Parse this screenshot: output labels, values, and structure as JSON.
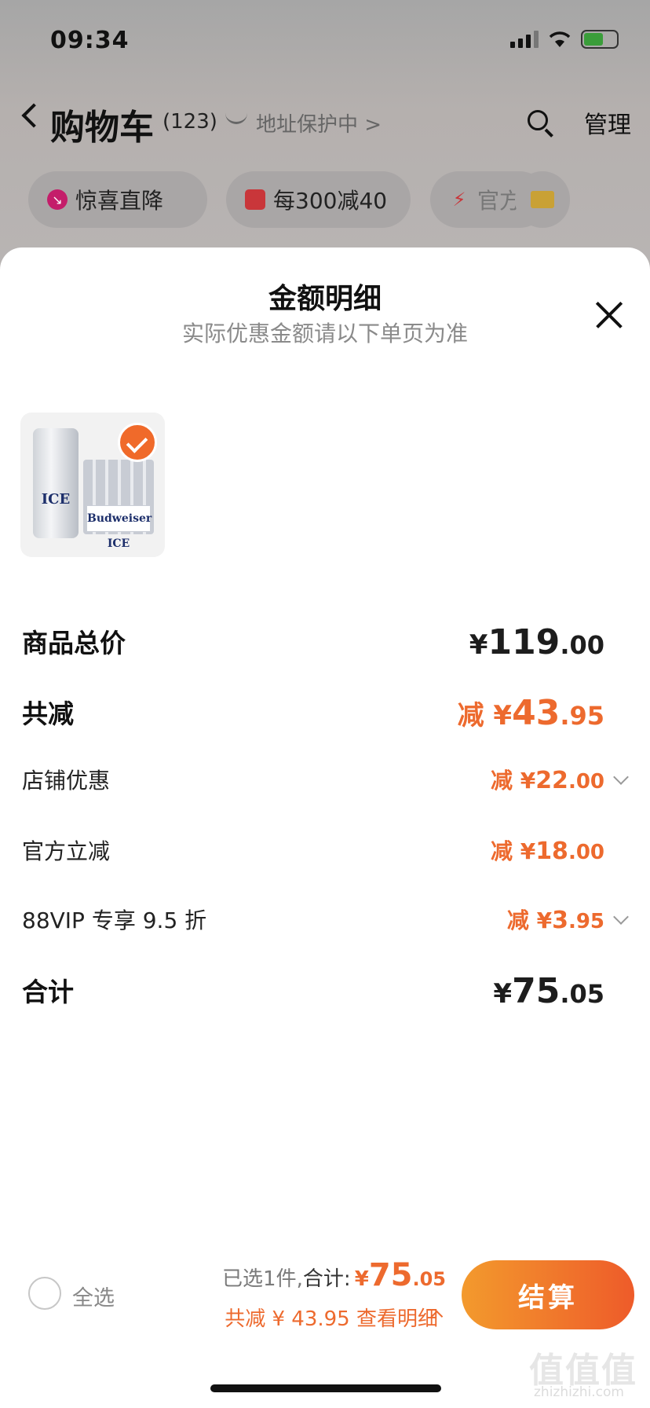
{
  "status_bar": {
    "time": "09:34"
  },
  "nav": {
    "title": "购物车",
    "count": "(123)",
    "address_text": "地址保护中 >",
    "manage": "管理"
  },
  "chips": [
    {
      "label": "惊喜直降",
      "icon": "arrow-down-icon",
      "color": "#d4206e"
    },
    {
      "label": "每300减40",
      "icon": "shop-icon",
      "color": "#e0423a"
    },
    {
      "label": "官方",
      "icon": "lightning-icon",
      "color": "#e0423a"
    }
  ],
  "sheet": {
    "title": "金额明细",
    "subtitle": "实际优惠金额请以下单页为准",
    "product_image": {
      "can_text": "ICE",
      "case_text": "Budweiser ICE"
    }
  },
  "breakdown": {
    "total_price": {
      "label": "商品总价",
      "prefix": "¥",
      "int": "119",
      "dec": ".00"
    },
    "total_discount": {
      "label": "共减",
      "prefix": "减 ¥",
      "int": "43",
      "dec": ".95"
    },
    "store_discount": {
      "label": "店铺优惠",
      "prefix": "减 ¥",
      "int": "22",
      "dec": ".00"
    },
    "official_discount": {
      "label": "官方立减",
      "prefix": "减 ¥",
      "int": "18",
      "dec": ".00"
    },
    "vip_discount": {
      "label": "88VIP 专享 9.5 折",
      "prefix": "减 ¥",
      "int": "3",
      "dec": ".95"
    },
    "grand_total": {
      "label": "合计",
      "prefix": "¥",
      "int": "75",
      "dec": ".05"
    }
  },
  "bottom_bar": {
    "select_all": "全选",
    "selected_count": "已选1件,",
    "total_label": "合计:",
    "total_yen": "¥",
    "total_int": "75",
    "total_dec": ".05",
    "discount_summary": "共减 ¥ 43.95 查看明细",
    "checkout": "结算"
  },
  "watermark": {
    "main": "值值值",
    "sub": "zhizhizhi.com"
  },
  "colors": {
    "accent": "#ed6a2e",
    "checkout_gradient_start": "#f39a2d",
    "checkout_gradient_end": "#ee5b2a"
  }
}
